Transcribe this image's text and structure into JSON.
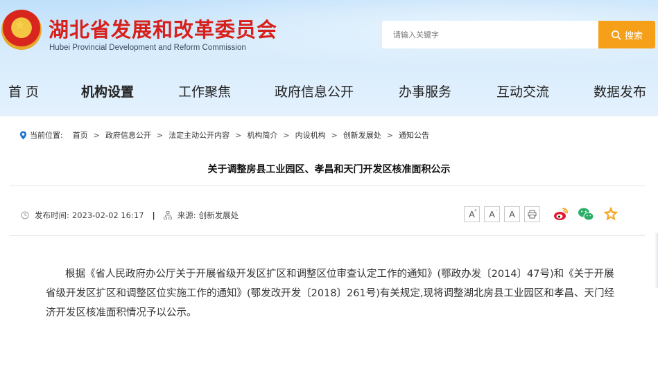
{
  "header": {
    "title": "湖北省发展和改革委员会",
    "subtitle": "Hubei Provincial Development and Reform Commission",
    "search_placeholder": "请输入关键字",
    "search_button": "搜索"
  },
  "nav": {
    "items": [
      {
        "label": "首 页",
        "active": false
      },
      {
        "label": "机构设置",
        "active": true
      },
      {
        "label": "工作聚焦",
        "active": false
      },
      {
        "label": "政府信息公开",
        "active": false
      },
      {
        "label": "办事服务",
        "active": false
      },
      {
        "label": "互动交流",
        "active": false
      },
      {
        "label": "数据发布",
        "active": false
      }
    ]
  },
  "breadcrumb": {
    "prefix": "当前位置:",
    "items": [
      "首页",
      "政府信息公开",
      "法定主动公开内容",
      "机构简介",
      "内设机构",
      "创新发展处",
      "通知公告"
    ],
    "separator": ">"
  },
  "article": {
    "title": "关于调整房县工业园区、孝昌和天门开发区核准面积公示",
    "publish_label": "发布时间:",
    "publish_time": "2023-02-02 16:17",
    "source_label": "来源:",
    "source": "创新发展处",
    "body": "根据《省人民政府办公厅关于开展省级开发区扩区和调整区位审查认定工作的通知》(鄂政办发〔2014〕47号)和《关于开展省级开发区扩区和调整区位实施工作的通知》(鄂发改开发〔2018〕261号)有关规定,现将调整湖北房县工业园区和孝昌、天门经济开发区核准面积情况予以公示。"
  },
  "tools": {
    "font_large": "A",
    "font_medium": "A",
    "font_small": "A",
    "print_icon": "print-icon",
    "share": [
      "weibo-icon",
      "wechat-icon",
      "favorite-icon"
    ]
  },
  "colors": {
    "title_red": "#d8201b",
    "search_orange": "#f6a01a",
    "weibo": "#e6162d",
    "wechat": "#2aae67",
    "favorite": "#f5a623",
    "location": "#1e73d2"
  }
}
